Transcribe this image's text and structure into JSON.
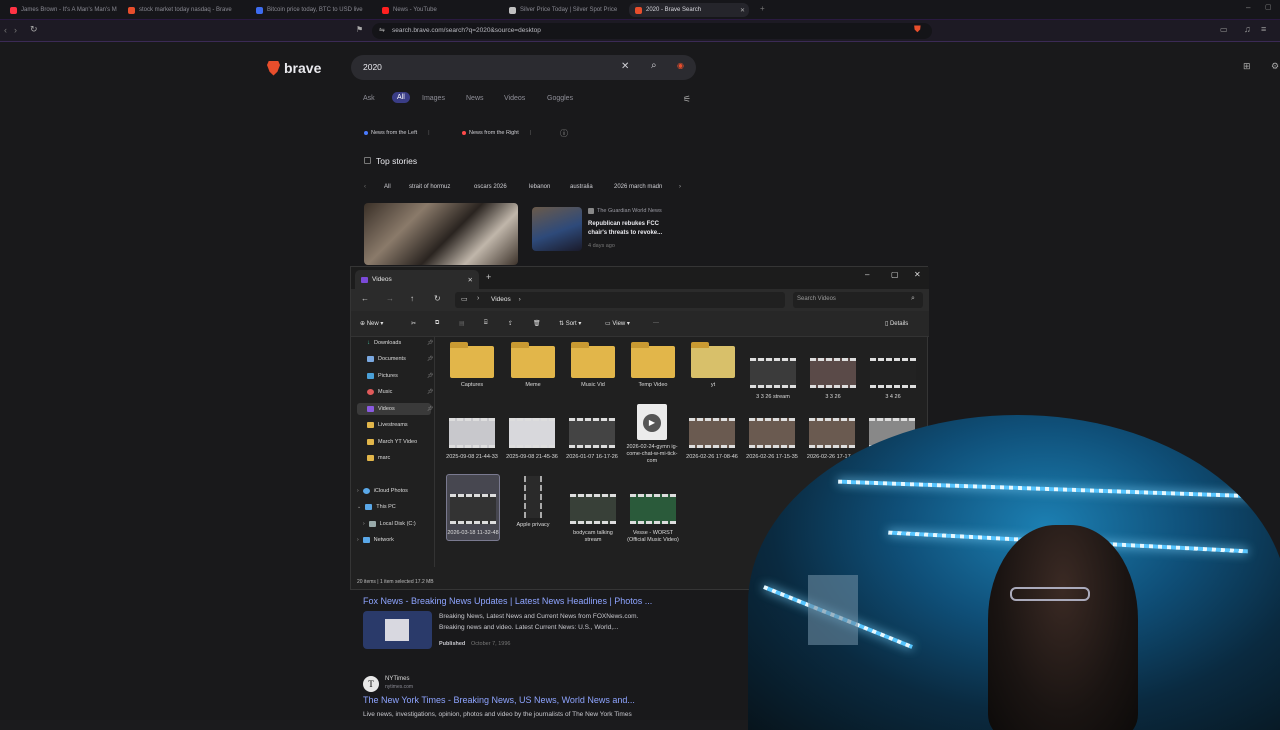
{
  "browser": {
    "tabs": [
      {
        "label": "James Brown - It's A Man's Man's M",
        "color": "#ff3344"
      },
      {
        "label": "stock market today nasdaq - Brave",
        "color": "#e84e2c"
      },
      {
        "label": "Bitcoin price today, BTC to USD live",
        "color": "#3d6cf0"
      },
      {
        "label": "News - YouTube",
        "color": "#ff2020"
      },
      {
        "label": "Silver Price Today | Silver Spot Price",
        "color": "#c0c0c0"
      },
      {
        "label": "2020 - Brave Search",
        "color": "#e84e2c"
      }
    ],
    "url": "search.brave.com/search?q=2020&source=desktop"
  },
  "search": {
    "brand": "brave",
    "query": "2020",
    "tabs": [
      "Ask",
      "All",
      "Images",
      "News",
      "Videos",
      "Goggles"
    ],
    "perspective_left": "News from the Left",
    "perspective_right": "News from the Right",
    "top_stories_label": "Top stories",
    "chips": [
      "All",
      "strait of hormuz",
      "oscars 2026",
      "lebanon",
      "australia",
      "2026 march madn"
    ],
    "story": {
      "source": "The Guardian World News",
      "headline": "Republican rebukes FCC chair's threats to revoke...",
      "age": "4 days ago"
    }
  },
  "explorer": {
    "tab_title": "Videos",
    "breadcrumb": "Videos",
    "search_placeholder": "Search Videos",
    "commands": {
      "new": "New",
      "sort": "Sort",
      "view": "View",
      "details": "Details"
    },
    "sidebar": [
      {
        "label": "Downloads",
        "pinned": true
      },
      {
        "label": "Documents",
        "pinned": true
      },
      {
        "label": "Pictures",
        "pinned": true
      },
      {
        "label": "Music",
        "pinned": true
      },
      {
        "label": "Videos",
        "pinned": true
      },
      {
        "label": "Livestreams",
        "pinned": false
      },
      {
        "label": "March YT Video",
        "pinned": false
      },
      {
        "label": "marc",
        "pinned": false
      },
      {
        "label": "iCloud Photos",
        "pinned": false
      },
      {
        "label": "This PC",
        "pinned": false
      },
      {
        "label": "Local Disk (C:)",
        "pinned": false
      },
      {
        "label": "Network",
        "pinned": false
      }
    ],
    "items": [
      {
        "label": "Captures",
        "type": "folder"
      },
      {
        "label": "Meme",
        "type": "folder"
      },
      {
        "label": "Music Vid",
        "type": "folder"
      },
      {
        "label": "Temp Video",
        "type": "folder"
      },
      {
        "label": "yt",
        "type": "folder"
      },
      {
        "label": "3 3 26 stream",
        "type": "video"
      },
      {
        "label": "3 3 26",
        "type": "video"
      },
      {
        "label": "3 4 26",
        "type": "video"
      },
      {
        "label": "2025-09-08 21-44-33",
        "type": "video"
      },
      {
        "label": "2025-09-08 21-45-36",
        "type": "video"
      },
      {
        "label": "2026-01-07 16-17-26",
        "type": "video"
      },
      {
        "label": "2026-02-24-gymn ig-come-chat-w-mi-tick-com",
        "type": "doc"
      },
      {
        "label": "2026-02-26 17-08-46",
        "type": "video"
      },
      {
        "label": "2026-02-26 17-15-35",
        "type": "video"
      },
      {
        "label": "2026-02-26 17-17-...",
        "type": "video"
      },
      {
        "label": "",
        "type": "video"
      },
      {
        "label": "2026-03-18 11-32-48",
        "type": "video"
      },
      {
        "label": "Apple privacy",
        "type": "video"
      },
      {
        "label": "bodycam talking stream",
        "type": "video"
      },
      {
        "label": "Vesse - WORST (Official Music Video)",
        "type": "video"
      }
    ],
    "status": "20 items  |  1 item selected  17.2 MB"
  },
  "results": {
    "fox": {
      "title": "Fox News - Breaking News Updates | Latest News Headlines | Photos ...",
      "desc1": "Breaking News, Latest News and Current News from FOXNews.com.",
      "desc2": "Breaking news and video. Latest Current News: U.S., World,...",
      "published_label": "Published",
      "published_date": "October 7, 1996"
    },
    "nyt": {
      "site": "NYTimes",
      "domain": "nytimes.com",
      "title": "The New York Times - Breaking News, US News, World News and...",
      "desc": "Live news, investigations, opinion, photos and video by the journalists of The New York Times"
    }
  }
}
